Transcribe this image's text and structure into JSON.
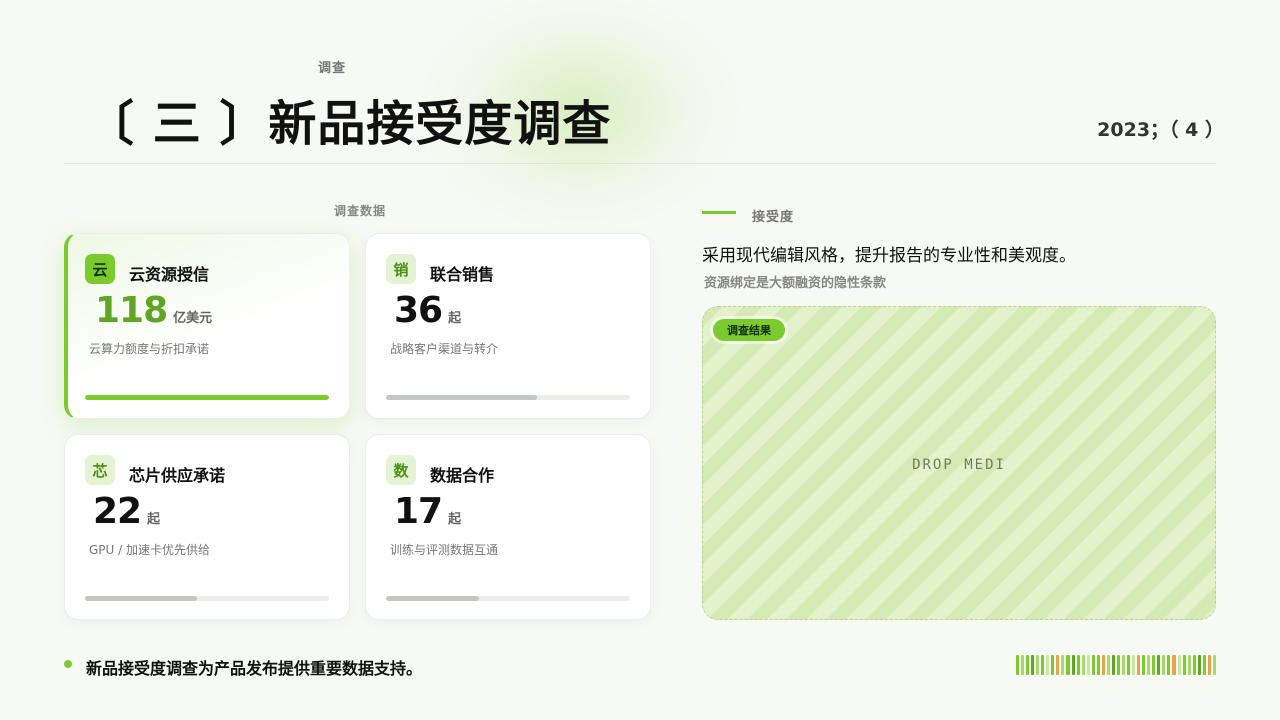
{
  "header": {
    "kicker": "调查",
    "title": "〔 三 〕新品接受度调查",
    "page_meta": "2023；（ 4 ）"
  },
  "data_section": {
    "label": "调查数据",
    "cards": [
      {
        "badge": "云",
        "title": "云资源授信",
        "value": "118",
        "unit": "亿美元",
        "desc": "云算力额度与折扣承诺",
        "progress": 1.0,
        "active": true
      },
      {
        "badge": "销",
        "title": "联合销售",
        "value": "36",
        "unit": "起",
        "desc": "战略客户渠道与转介",
        "progress": 0.62,
        "active": false
      },
      {
        "badge": "芯",
        "title": "芯片供应承诺",
        "value": "22",
        "unit": "起",
        "desc": "GPU /  加速卡优先供给",
        "progress": 0.46,
        "active": false
      },
      {
        "badge": "数",
        "title": "数据合作",
        "value": "17",
        "unit": "起",
        "desc": "训练与评测数据互通",
        "progress": 0.38,
        "active": false
      }
    ]
  },
  "right_section": {
    "label": "接受度",
    "lead": "采用现代编辑风格，提升报告的专业性和美观度。",
    "sub": "资源绑定是大额融资的隐性条款",
    "media_tag": "调查结果",
    "media_placeholder": "DROP MEDI"
  },
  "footer": {
    "text": "新品接受度调查为产品发布提供重要数据支持。"
  },
  "colors": {
    "accent": "#7ccb2e",
    "accent_dark": "#5fa624",
    "barcode": [
      "#7ccb2e",
      "#a8d86a",
      "#e8a24a",
      "#5fa624",
      "#c9e6a0"
    ]
  }
}
